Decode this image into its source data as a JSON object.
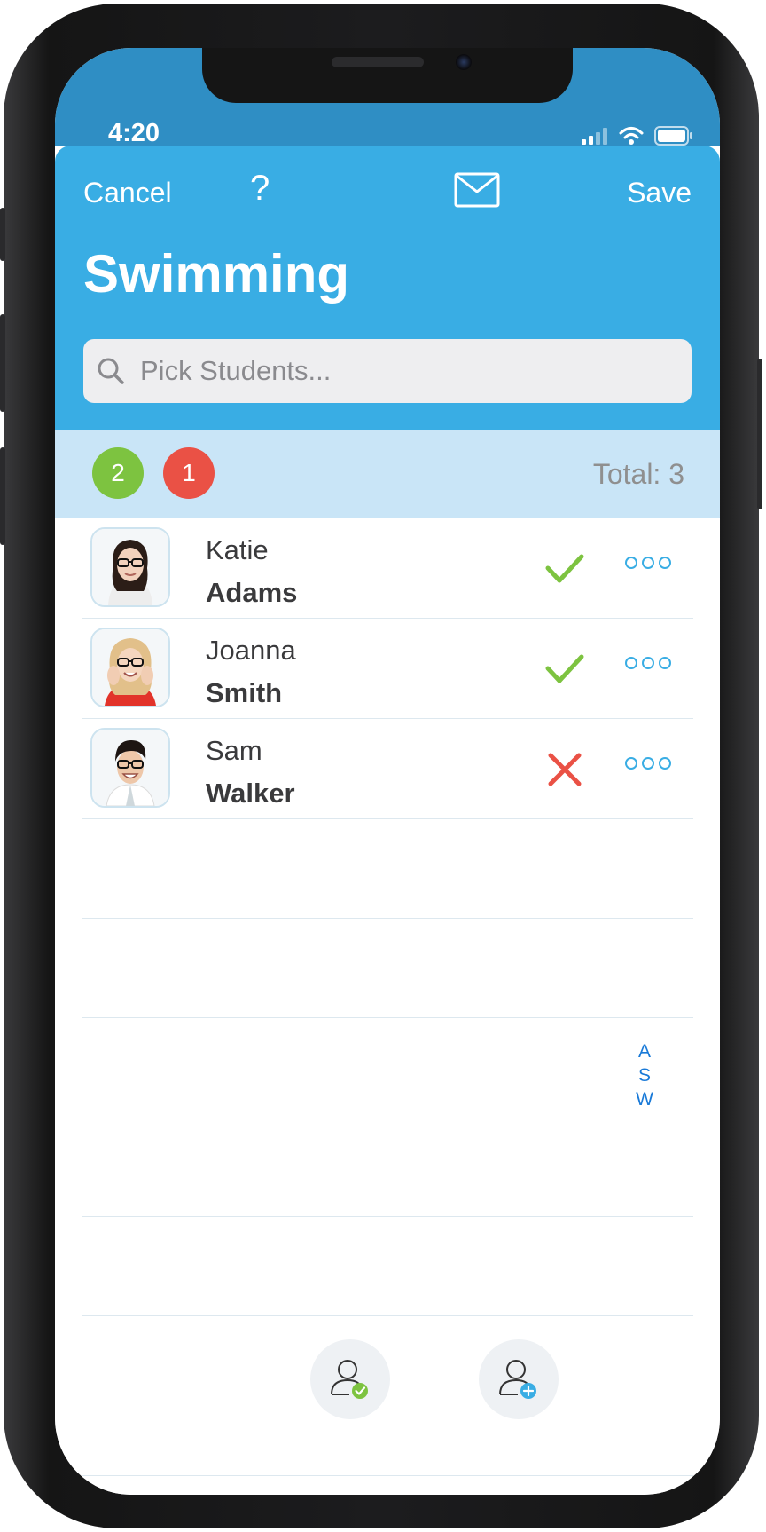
{
  "status_bar": {
    "time": "4:20"
  },
  "header": {
    "cancel_label": "Cancel",
    "help_label": "?",
    "save_label": "Save",
    "title": "Swimming",
    "accent_color": "#39ade4",
    "icons": [
      "help-icon",
      "mail-icon"
    ]
  },
  "search": {
    "placeholder": "Pick Students...",
    "value": ""
  },
  "summary": {
    "present_count": "2",
    "absent_count": "1",
    "total_label": "Total: 3",
    "present_color": "#7dc340",
    "absent_color": "#ea5145"
  },
  "students": [
    {
      "first_name": "Katie",
      "last_name": "Adams",
      "status": "present"
    },
    {
      "first_name": "Joanna",
      "last_name": "Smith",
      "status": "present"
    },
    {
      "first_name": "Sam",
      "last_name": "Walker",
      "status": "absent"
    }
  ],
  "index_letters": [
    "A",
    "S",
    "W"
  ],
  "bottom_actions": [
    {
      "icon": "person-check-icon"
    },
    {
      "icon": "person-add-icon"
    }
  ]
}
